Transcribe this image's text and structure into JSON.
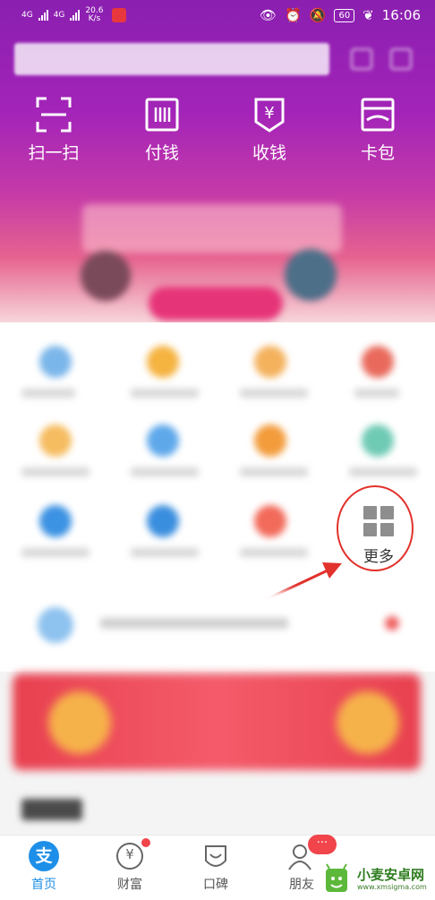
{
  "status_bar": {
    "signal_label_1": "4G",
    "signal_label_2": "4G",
    "net_speed_value": "20.6",
    "net_speed_unit": "K/s",
    "battery": "60",
    "time": "16:06"
  },
  "quick_actions": [
    {
      "label": "扫一扫",
      "icon": "scan-icon"
    },
    {
      "label": "付钱",
      "icon": "pay-code-icon"
    },
    {
      "label": "收钱",
      "icon": "receive-money-icon"
    },
    {
      "label": "卡包",
      "icon": "card-wallet-icon"
    }
  ],
  "more_tile": {
    "label": "更多",
    "icon": "grid-icon"
  },
  "tabbar": [
    {
      "label": "首页",
      "icon": "home-icon",
      "active": true
    },
    {
      "label": "财富",
      "icon": "wealth-icon"
    },
    {
      "label": "口碑",
      "icon": "koubei-icon"
    },
    {
      "label": "朋友",
      "icon": "friends-icon",
      "badge": "···"
    }
  ],
  "tab_icon_glyphs": {
    "home": "支",
    "wealth": "¥"
  },
  "watermark": {
    "title": "小麦安卓网",
    "url": "www.xmsigma.com"
  },
  "colors": {
    "header_purple": "#8a1fb0",
    "annotation_red": "#e2322c",
    "tab_active_blue": "#1e8fe8",
    "badge_red": "#f1444b"
  }
}
